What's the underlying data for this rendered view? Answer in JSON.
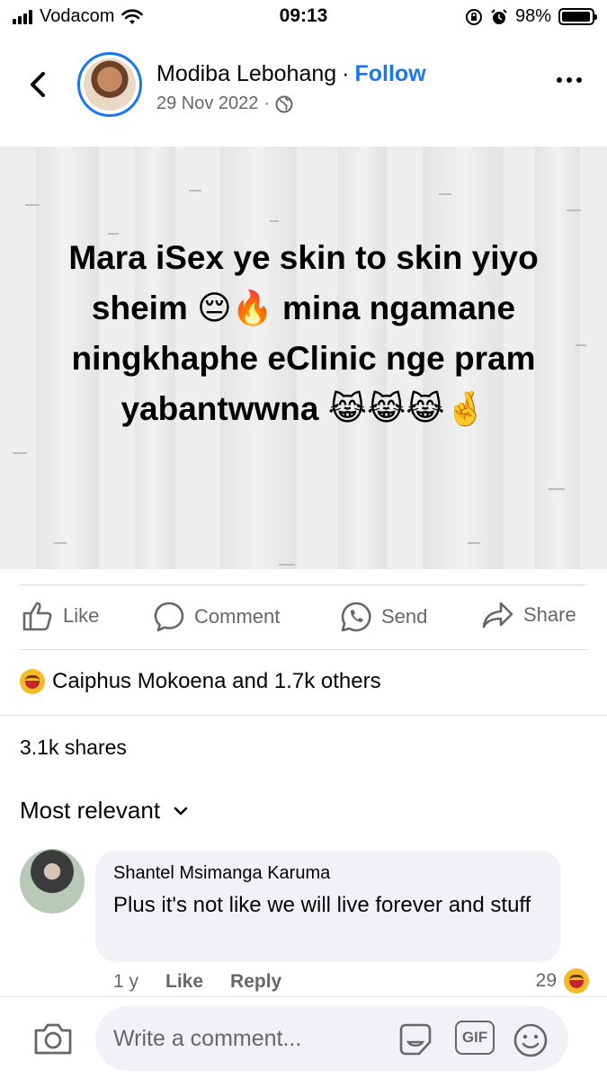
{
  "status_bar": {
    "carrier": "Vodacom",
    "time": "09:13",
    "battery": "98%",
    "battery_level": 0.98
  },
  "header": {
    "author": "Modiba Lebohang",
    "separator": "·",
    "follow_label": "Follow",
    "date": "29 Nov 2022",
    "meta_separator": "·",
    "audience_icon": "globe-icon"
  },
  "post": {
    "text": "Mara iSex ye skin to skin yiyo sheim 😔🔥 mina ngamane ningkhaphe eClinic nge pram yabantwwna 😹😹😹🤞"
  },
  "actions": {
    "like": "Like",
    "comment": "Comment",
    "send": "Send",
    "share": "Share"
  },
  "reactions": {
    "summary": "Caiphus Mokoena and 1.7k others",
    "icon": "haha-reaction-icon"
  },
  "shares": "3.1k shares",
  "sort": {
    "label": "Most relevant",
    "icon": "chevron-down-icon"
  },
  "comment": {
    "author": "Shantel Msimanga Karuma",
    "text": "Plus it's not like we will live forever and stuff",
    "age": "1 y",
    "like": "Like",
    "reply": "Reply",
    "reaction_count": "29"
  },
  "composer": {
    "placeholder": "Write a comment...",
    "gif": "GIF"
  },
  "colors": {
    "accent": "#1877f2",
    "secondary_text": "#65676b",
    "bubble": "#f0f2f5"
  }
}
